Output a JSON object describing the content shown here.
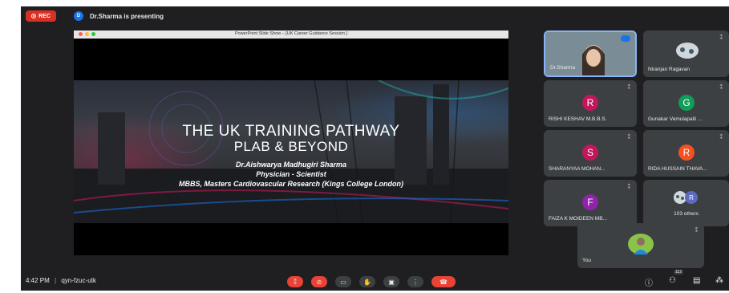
{
  "topbar": {
    "rec_label": "REC",
    "presenter_initial": "D",
    "presenter_text": "Dr.Sharma is presenting"
  },
  "window": {
    "title": "PowerPoint Slide Show – [UK Career Guidance Session ]"
  },
  "slide": {
    "title_line1": "THE UK TRAINING PATHWAY",
    "title_line2": "PLAB & BEYOND",
    "presenter_name": "Dr.Aishwarya Madhugiri Sharma",
    "role": "Physician - Scientist",
    "credentials": "MBBS, Masters Cardiovascular Research (Kings College London)"
  },
  "participants": [
    {
      "name": "Dr.Sharma",
      "type": "video"
    },
    {
      "name": "Niranjan Ragavan",
      "type": "image"
    },
    {
      "name": "RISHI KESHAV M.B.B.S.",
      "initial": "R",
      "color": "#c2185b"
    },
    {
      "name": "Gunakar Vemulapalli ...",
      "initial": "G",
      "color": "#0f9d58"
    },
    {
      "name": "SHARANYAA MOHAN...",
      "initial": "S",
      "color": "#c2185b"
    },
    {
      "name": "RIDA HUSSAIN THAVA...",
      "initial": "R",
      "color": "#f4511e"
    },
    {
      "name": "FAIZA K MOIDEEN MB...",
      "initial": "F",
      "color": "#8e24aa"
    }
  ],
  "others": {
    "label": "103 others",
    "initial": "R",
    "color": "#5c6bc0"
  },
  "self": {
    "label": "You"
  },
  "bottombar": {
    "time": "4:42 PM",
    "separator": "|",
    "meeting_code": "qyn-fzuc-utk",
    "people_count": "112"
  },
  "icons": [
    "mic-off-icon",
    "camera-off-icon",
    "captions-icon",
    "raise-hand-icon",
    "present-icon",
    "more-icon",
    "end-call-icon",
    "info-icon",
    "people-icon",
    "chat-icon",
    "activities-icon"
  ],
  "colors": {
    "background": "#1f1f21",
    "tile": "#3c4043",
    "accent_red": "#ea4335",
    "accent_blue": "#1a73e8"
  }
}
